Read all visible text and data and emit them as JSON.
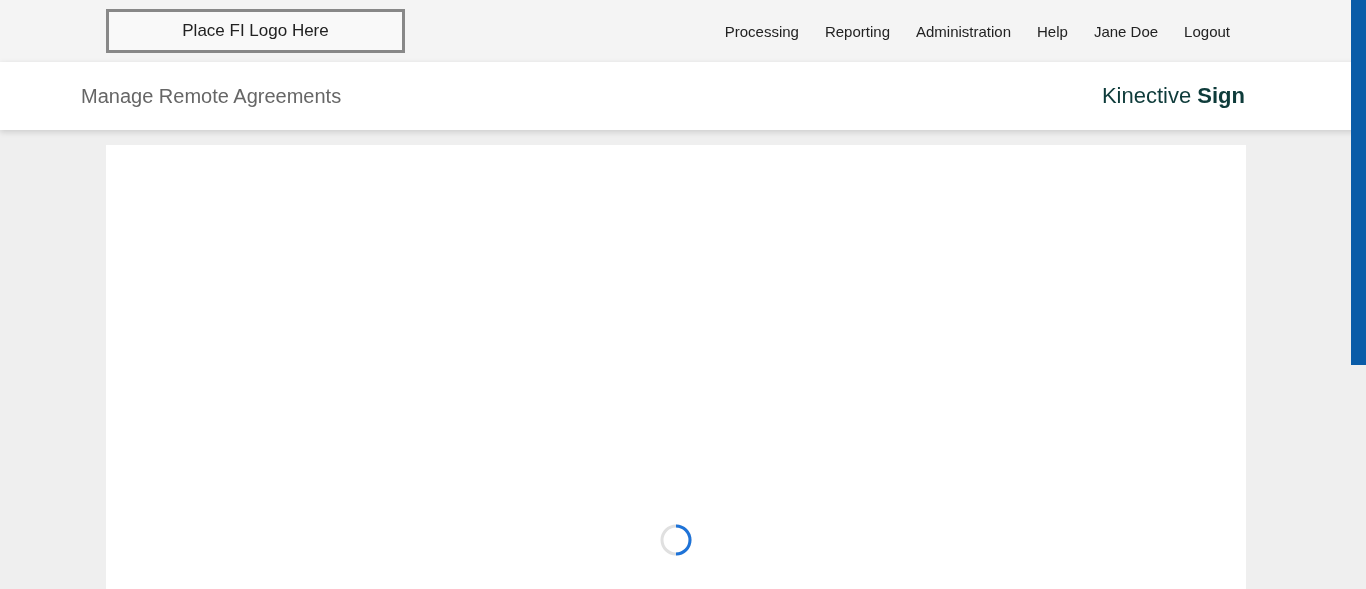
{
  "header": {
    "logo_placeholder": "Place FI Logo Here",
    "nav": [
      "Processing",
      "Reporting",
      "Administration",
      "Help",
      "Jane Doe",
      "Logout"
    ]
  },
  "subheader": {
    "title": "Manage Remote Agreements",
    "brand": "Kinective **Sign**"
  },
  "content": {
    "loading": true
  }
}
